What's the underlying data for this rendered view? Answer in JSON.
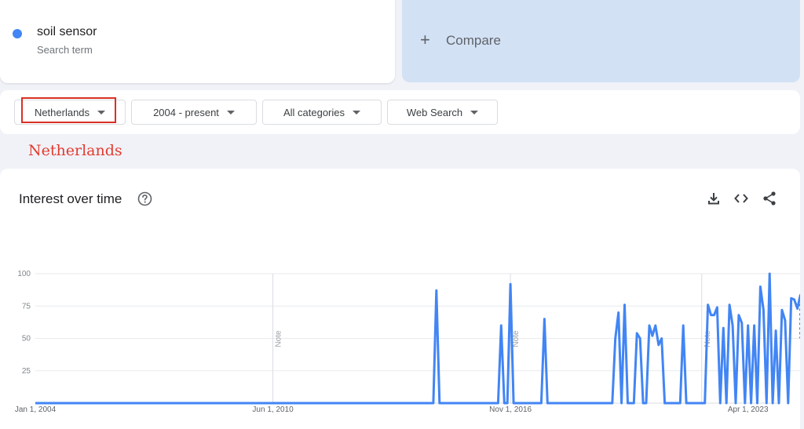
{
  "search_term": {
    "name": "soil sensor",
    "subtitle": "Search term",
    "color": "#4285f4"
  },
  "compare": {
    "label": "Compare"
  },
  "filters": {
    "region": "Netherlands",
    "time_range": "2004 - present",
    "category": "All categories",
    "search_type": "Web Search"
  },
  "annotation": {
    "text": "Netherlands",
    "color": "#e33b2e"
  },
  "panel": {
    "title": "Interest over time"
  },
  "icons": [
    "help-icon",
    "download-icon",
    "embed-icon",
    "share-icon"
  ],
  "colors": {
    "series": "#4285f4",
    "compare_bg": "#d3e1f5",
    "highlight": "#d93025"
  },
  "chart_data": {
    "type": "line",
    "ylim": [
      0,
      100
    ],
    "y_ticks": [
      "25",
      "50",
      "75",
      "100"
    ],
    "x_ticks": [
      "Jan 1, 2004",
      "Jun 1, 2010",
      "Nov 1, 2016",
      "Apr 1, 2023"
    ],
    "x_range": [
      "2004-01",
      "2024-02"
    ],
    "grid": true,
    "notes": [
      {
        "date": "2010-06",
        "label": "Note"
      },
      {
        "date": "2016-11",
        "label": "Note"
      },
      {
        "date": "2022-01",
        "label": "Note"
      }
    ],
    "series": [
      {
        "color": "#4285f4",
        "points": [
          [
            "2004-01",
            0
          ],
          [
            "2014-10",
            0
          ],
          [
            "2014-11",
            87
          ],
          [
            "2014-12",
            0
          ],
          [
            "2016-07",
            0
          ],
          [
            "2016-08",
            60
          ],
          [
            "2016-09",
            0
          ],
          [
            "2016-10",
            0
          ],
          [
            "2016-11",
            92
          ],
          [
            "2016-12",
            0
          ],
          [
            "2017-09",
            0
          ],
          [
            "2017-10",
            65
          ],
          [
            "2017-11",
            0
          ],
          [
            "2019-08",
            0
          ],
          [
            "2019-09",
            50
          ],
          [
            "2019-10",
            70
          ],
          [
            "2019-11",
            0
          ],
          [
            "2019-12",
            76
          ],
          [
            "2020-01",
            0
          ],
          [
            "2020-03",
            0
          ],
          [
            "2020-04",
            54
          ],
          [
            "2020-05",
            50
          ],
          [
            "2020-06",
            0
          ],
          [
            "2020-07",
            0
          ],
          [
            "2020-08",
            60
          ],
          [
            "2020-09",
            52
          ],
          [
            "2020-10",
            60
          ],
          [
            "2020-11",
            45
          ],
          [
            "2020-12",
            50
          ],
          [
            "2021-01",
            0
          ],
          [
            "2021-06",
            0
          ],
          [
            "2021-07",
            60
          ],
          [
            "2021-08",
            0
          ],
          [
            "2022-02",
            0
          ],
          [
            "2022-03",
            76
          ],
          [
            "2022-04",
            68
          ],
          [
            "2022-05",
            68
          ],
          [
            "2022-06",
            74
          ],
          [
            "2022-07",
            0
          ],
          [
            "2022-08",
            58
          ],
          [
            "2022-09",
            0
          ],
          [
            "2022-10",
            76
          ],
          [
            "2022-11",
            60
          ],
          [
            "2022-12",
            0
          ],
          [
            "2023-01",
            68
          ],
          [
            "2023-02",
            62
          ],
          [
            "2023-03",
            0
          ],
          [
            "2023-04",
            60
          ],
          [
            "2023-05",
            0
          ],
          [
            "2023-06",
            60
          ],
          [
            "2023-07",
            0
          ],
          [
            "2023-08",
            90
          ],
          [
            "2023-09",
            72
          ],
          [
            "2023-10",
            0
          ],
          [
            "2023-11",
            100
          ],
          [
            "2023-12",
            0
          ],
          [
            "2024-01",
            56
          ],
          [
            "2024-02",
            0
          ],
          [
            "2024-03",
            72
          ],
          [
            "2024-04",
            64
          ],
          [
            "2024-05",
            0
          ],
          [
            "2024-06",
            81
          ],
          [
            "2024-07",
            80
          ],
          [
            "2024-08",
            73
          ],
          [
            "2024-09",
            84
          ]
        ],
        "partial_from": "2024-09",
        "partial_value": 50
      }
    ]
  }
}
